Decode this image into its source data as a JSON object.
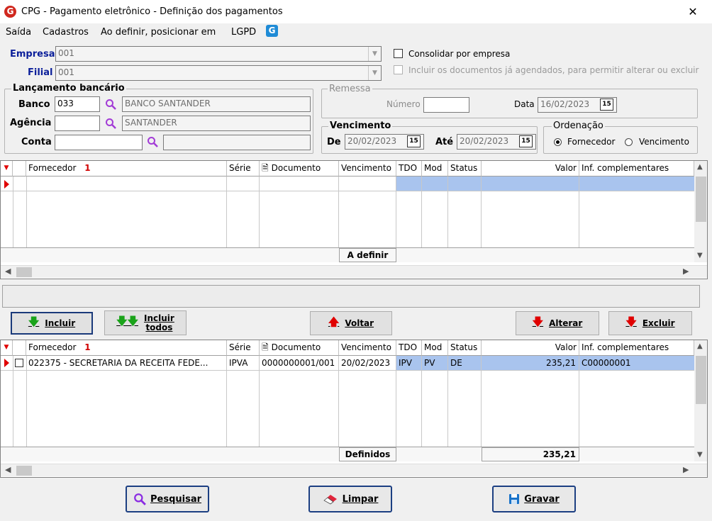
{
  "window": {
    "title": "CPG - Pagamento eletrônico - Definição dos pagamentos",
    "icon_letter": "G",
    "close": "✕"
  },
  "menu": {
    "items": [
      "Saída",
      "Cadastros",
      "Ao definir, posicionar em",
      "LGPD"
    ],
    "lgpd_icon_letter": "G"
  },
  "filters": {
    "empresa_label": "Empresa",
    "empresa_value": "001",
    "filial_label": "Filial",
    "filial_value": "001",
    "consolidar_label": "Consolidar por empresa",
    "incluir_agendados_label": "Incluir os documentos já agendados, para permitir alterar ou excluir"
  },
  "lancamento": {
    "title": "Lançamento bancário",
    "banco_label": "Banco",
    "banco_code": "033",
    "banco_name": "BANCO SANTANDER",
    "agencia_label": "Agência",
    "agencia_code": "",
    "agencia_name": "SANTANDER",
    "conta_label": "Conta",
    "conta_value": "",
    "conta_name": ""
  },
  "remessa": {
    "title": "Remessa",
    "numero_label": "Número",
    "numero_value": "",
    "data_label": "Data",
    "data_value": "16/02/2023",
    "cal_label": "15"
  },
  "vencimento": {
    "title": "Vencimento",
    "de_label": "De",
    "de_value": "20/02/2023",
    "ate_label": "Até",
    "ate_value": "20/02/2023",
    "cal_label": "15"
  },
  "ordenacao": {
    "title": "Ordenação",
    "options": [
      "Fornecedor",
      "Vencimento"
    ],
    "selected": "Fornecedor"
  },
  "grid_columns": [
    "Fornecedor",
    "Série",
    "Documento",
    "Vencimento",
    "TDO",
    "Mod",
    "Status",
    "Valor",
    "Inf. complementares"
  ],
  "sort_indicator": "1",
  "grid_top": {
    "footer_label": "A definir",
    "rows": []
  },
  "buttons": {
    "incluir": "Incluir",
    "incluir_todos_1": "Incluir",
    "incluir_todos_2": "todos",
    "voltar": "Voltar",
    "alterar": "Alterar",
    "excluir": "Excluir"
  },
  "grid_bottom": {
    "rows": [
      {
        "fornecedor": "022375 - SECRETARIA DA RECEITA FEDE...",
        "serie": "IPVA",
        "documento": "0000000001/001",
        "vencimento": "20/02/2023",
        "tdo": "IPV",
        "mod": "PV",
        "status": "DE",
        "valor": "235,21",
        "inf": "C00000001"
      }
    ],
    "footer_label": "Definidos",
    "footer_total": "235,21"
  },
  "bottom_buttons": {
    "pesquisar": "Pesquisar",
    "limpar": "Limpar",
    "gravar": "Gravar"
  },
  "colors": {
    "selection": "#a9c4ee",
    "accent_red": "#d0281e",
    "label_blue": "#0b1f9a"
  }
}
